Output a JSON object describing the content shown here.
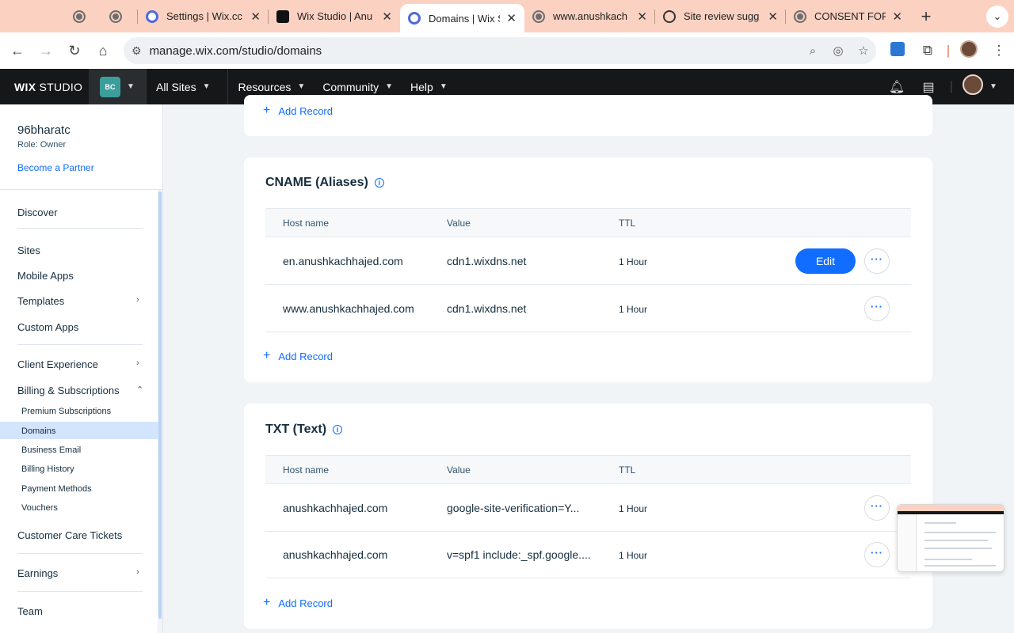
{
  "browser": {
    "tabs": [
      {
        "label": "",
        "kind": "globe"
      },
      {
        "label": "",
        "kind": "globe"
      },
      {
        "label": "Settings | Wix.cc",
        "kind": "wix"
      },
      {
        "label": "Wix Studio | Anu",
        "kind": "wixstudio"
      },
      {
        "label": "Domains | Wix S",
        "kind": "wix",
        "active": true
      },
      {
        "label": "www.anushkach",
        "kind": "globe"
      },
      {
        "label": "Site review sugg",
        "kind": "openai"
      },
      {
        "label": "CONSENT FORM",
        "kind": "globe"
      }
    ],
    "new_tab": "+",
    "url": "manage.wix.com/studio/domains"
  },
  "wix_header": {
    "logo_bold": "WIX",
    "logo_light": "STUDIO",
    "site_badge": "BC",
    "menu": [
      "All Sites",
      "Resources",
      "Community",
      "Help"
    ]
  },
  "sidebar": {
    "account_name": "96bharatc",
    "account_role": "Role: Owner",
    "partner_link": "Become a Partner",
    "items": {
      "discover": "Discover",
      "sites": "Sites",
      "mobile_apps": "Mobile Apps",
      "templates": "Templates",
      "custom_apps": "Custom Apps",
      "client_experience": "Client Experience",
      "billing": "Billing & Subscriptions",
      "premium": "Premium Subscriptions",
      "domains": "Domains",
      "business_email": "Business Email",
      "billing_history": "Billing History",
      "payment_methods": "Payment Methods",
      "vouchers": "Vouchers",
      "care_tickets": "Customer Care Tickets",
      "earnings": "Earnings",
      "team": "Team"
    }
  },
  "main": {
    "top_add_record": "Add Record",
    "cname": {
      "title": "CNAME (Aliases)",
      "headers": [
        "Host name",
        "Value",
        "TTL"
      ],
      "rows": [
        {
          "host": "en.anushkachhajed.com",
          "value": "cdn1.wixdns.net",
          "ttl": "1 Hour",
          "edit": "Edit"
        },
        {
          "host": "www.anushkachhajed.com",
          "value": "cdn1.wixdns.net",
          "ttl": "1 Hour"
        }
      ],
      "add_record": "Add Record"
    },
    "txt": {
      "title": "TXT (Text)",
      "headers": [
        "Host name",
        "Value",
        "TTL"
      ],
      "rows": [
        {
          "host": "anushkachhajed.com",
          "value": "google-site-verification=Y...",
          "ttl": "1 Hour"
        },
        {
          "host": "anushkachhajed.com",
          "value": "v=spf1 include:_spf.google....",
          "ttl": "1 Hour"
        }
      ],
      "add_record": "Add Record"
    }
  },
  "colors": {
    "accent": "#116dff",
    "tabstrip": "#fbd2c2",
    "wix_bar": "#151719",
    "active_nav": "#d3e4fd"
  }
}
